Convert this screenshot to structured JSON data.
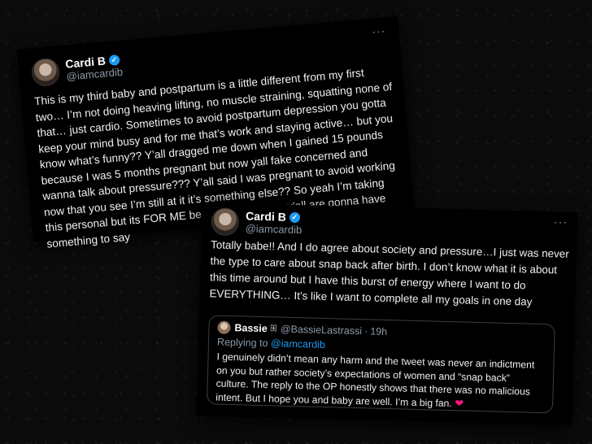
{
  "tweet1": {
    "name": "Cardi B",
    "handle": "@iamcardib",
    "text": "This is my third baby and postpartum is a little different from my first two… I’m not doing heaving lifting, no muscle straining, squatting none of that… just cardio. Sometimes to avoid postpartum depression you gotta keep your mind busy and for me that’s work and staying active… but you know what’s funny?? Y’all dragged me down when I gained 15 pounds because I was 5 months pregnant but now yall fake concerned and wanna talk about pressure??? Y’all said I was pregnant to avoid working now that you see I’m still at it it’s something else?? So yeah I’m  taking this personal but its FOR ME because either way y’all are gonna have something to say",
    "more_icon": "ellipsis-icon"
  },
  "tweet2": {
    "name": "Cardi B",
    "handle": "@iamcardib",
    "text": "Totally babe!! And I do agree about society and pressure…I just was never the type to care about snap back after birth. I don’t know what it is about this time around but I have this burst of energy where I want to do EVERYTHING… It’s like I want to complete all my goals in one day",
    "more_icon": "ellipsis-icon",
    "quote": {
      "name": "Bassie",
      "badge": "ꕤ",
      "handle": "@BassieLastrassi",
      "separator": "·",
      "time": "19h",
      "replying_prefix": "Replying to",
      "replying_handle": "@iamcardib",
      "text": "I genuinely didn’t mean any harm and the tweet was never an indictment on you but rather society’s expectations of women and “snap back” culture. The reply to the OP honestly shows that there was no malicious intent. But I hope you and baby are well. I’m a big fan.",
      "emoji": "❤"
    }
  },
  "colors": {
    "verified": "#1d9bf0",
    "handle": "#8b98a5",
    "heart": "#f91880"
  }
}
